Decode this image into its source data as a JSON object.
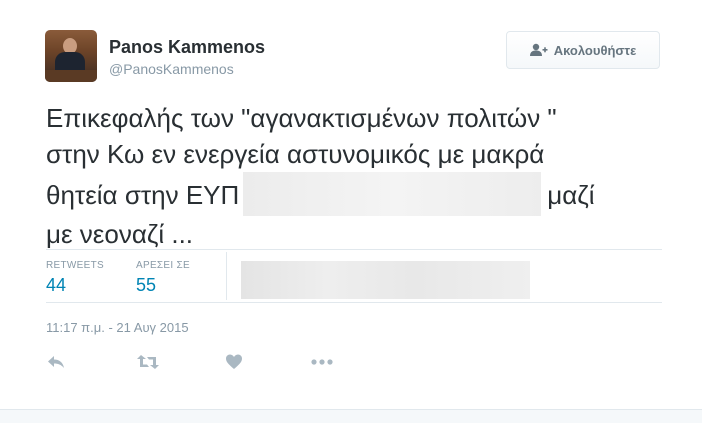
{
  "author": {
    "name": "Panos Kammenos",
    "handle": "@PanosKammenos"
  },
  "follow_button": {
    "label": "Ακολουθήστε",
    "icon": "add-user-icon"
  },
  "tweet": {
    "text_lines": [
      "Επικεφαλής των \"αγανακτισμένων πολιτών \"",
      "στην Κω εν ενεργεία αστυνομικός με μακρά",
      "θητεία στην ΕΥΠ",
      "μαζί",
      "με νεοναζί ..."
    ]
  },
  "stats": {
    "retweets_label": "RETWEETS",
    "retweets_value": "44",
    "likes_label": "ΑΡΕΣΕΙ ΣΕ",
    "likes_value": "55"
  },
  "timestamp": "11:17 π.μ. - 21 Αυγ 2015",
  "actions": {
    "icons": [
      "reply-icon",
      "retweet-icon",
      "heart-icon",
      "more-icon"
    ]
  },
  "colors": {
    "link": "#0084b4",
    "muted": "#8899a6",
    "text": "#292f33"
  }
}
